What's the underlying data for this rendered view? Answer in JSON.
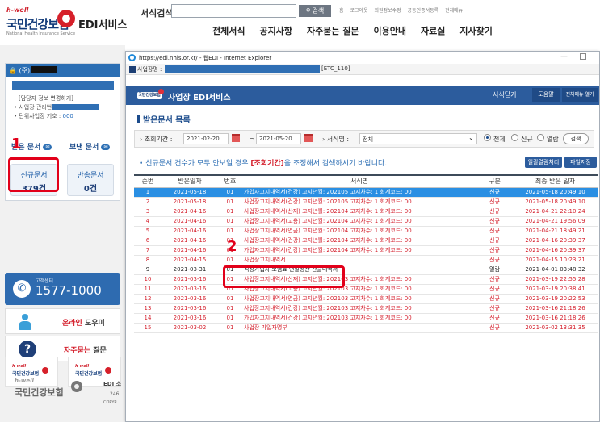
{
  "header": {
    "logo_small": "h-well",
    "logo_main": "국민건강보험",
    "logo_sub": "National Health Insurance Service",
    "service_title": "EDI서비스",
    "search_label": "서식검색",
    "search_value": "",
    "search_button": "검색",
    "util_links": [
      "홈",
      "로그아웃",
      "회원정보수정",
      "공동인증서등록",
      "전체메뉴"
    ],
    "nav": [
      "전체서식",
      "공지사항",
      "자주묻는 질문",
      "이용안내",
      "자료실",
      "지사찾기"
    ]
  },
  "sidebar": {
    "user_prefix": "(주)",
    "user_change": "[담당자 정보 변경하기]",
    "manager_label": "사업장 관리번",
    "unit_label": "단위사업장 기호 : ",
    "unit_value": "000",
    "tab_received": "받은 문서",
    "tab_sent": "보낸 문서",
    "new_docs_label": "신규문서",
    "new_docs_count": "379건",
    "returned_docs_label": "반송문서",
    "returned_docs_count": "0건",
    "annotation_1": "1",
    "call_label": "고객센터",
    "call_number": "1577-1000",
    "online_label": "온라인",
    "online_rest": " 도우미",
    "faq_label": "자주묻는",
    "faq_rest": " 질문",
    "banner_small": "h-well",
    "banner_name": "국민건강보험",
    "footer_small": "h-well",
    "footer_name": "국민건강보험",
    "footer_edi": "EDI 소",
    "footer_num": "246",
    "footer_copy": "COPYR"
  },
  "popup": {
    "window_title": "https://edi.nhis.or.kr/ - 웹EDI - Internet Explorer",
    "addr_label": "사업장명 :",
    "addr_code": "[ETC_110]",
    "app_logo": "국민건강보험",
    "app_title": "사업장 EDI서비스",
    "close_label": "서식닫기",
    "help_label": "도움말",
    "menu_label": "전체메뉴 열기",
    "list_title": "받은문서 목록",
    "filter": {
      "period_label": "조회기간 :",
      "date_from": "2021-02-20",
      "date_to": "2021-05-20",
      "form_label": "서식명 :",
      "form_value": "전체",
      "radio_all": "전체",
      "radio_new": "신규",
      "radio_read": "열람",
      "search_button": "검색"
    },
    "notice_prefix": "신규문서 건수가 모두 안보일 경우 ",
    "notice_highlight": "[조회기간]",
    "notice_suffix": "을 조정해서 검색하시기 바랍니다.",
    "bulk_button": "일괄열람처리",
    "file_button": "파일저장",
    "annotation_2": "2",
    "columns": [
      "순번",
      "받은일자",
      "번호",
      "서식명",
      "구분",
      "최종 받은 일자"
    ],
    "rows": [
      {
        "no": "1",
        "date": "2021-05-18",
        "num": "01",
        "title": "가입자고지내역서(건강) 고지년월: 202105 고지차수: 1 회계코드: 00",
        "type": "신규",
        "last": "2021-05-18 20:49:10"
      },
      {
        "no": "2",
        "date": "2021-05-18",
        "num": "01",
        "title": "사업장고지내역서(건강) 고지년월: 202105 고지차수: 1 회계코드: 00",
        "type": "신규",
        "last": "2021-05-18 20:49:10"
      },
      {
        "no": "3",
        "date": "2021-04-16",
        "num": "01",
        "title": "사업장고지내역서(산재) 고지년월: 202104 고지차수: 1 회계코드: 00",
        "type": "신규",
        "last": "2021-04-21 22:10:24"
      },
      {
        "no": "4",
        "date": "2021-04-16",
        "num": "01",
        "title": "사업장고지내역서(고용) 고지년월: 202104 고지차수: 1 회계코드: 00",
        "type": "신규",
        "last": "2021-04-21 19:56:09"
      },
      {
        "no": "5",
        "date": "2021-04-16",
        "num": "01",
        "title": "사업장고지내역서(연금) 고지년월: 202104 고지차수: 1 회계코드: 00",
        "type": "신규",
        "last": "2021-04-21 18:49:21"
      },
      {
        "no": "6",
        "date": "2021-04-16",
        "num": "01",
        "title": "사업장고지내역서(건강) 고지년월: 202104 고지차수: 1 회계코드: 00",
        "type": "신규",
        "last": "2021-04-16 20:39:37"
      },
      {
        "no": "7",
        "date": "2021-04-16",
        "num": "01",
        "title": "가입자고지내역서(건강) 고지년월: 202104 고지차수: 1 회계코드: 00",
        "type": "신규",
        "last": "2021-04-16 20:39:37"
      },
      {
        "no": "8",
        "date": "2021-04-15",
        "num": "01",
        "title": "사업장고지내역서",
        "type": "신규",
        "last": "2021-04-15 10:23:21"
      },
      {
        "no": "9",
        "date": "2021-03-31",
        "num": "01",
        "title": "직장가입자 보험료 연말정산 산출내역서",
        "type": "열람",
        "last": "2021-04-01 03:48:32"
      },
      {
        "no": "10",
        "date": "2021-03-16",
        "num": "01",
        "title": "사업장고지내역서(산재) 고지년월: 202103 고지차수: 1 회계코드: 00",
        "type": "신규",
        "last": "2021-03-19 22:55:28"
      },
      {
        "no": "11",
        "date": "2021-03-16",
        "num": "01",
        "title": "사업장고지내역서(고용) 고지년월: 202103 고지차수: 1 회계코드: 00",
        "type": "신규",
        "last": "2021-03-19 20:38:41"
      },
      {
        "no": "12",
        "date": "2021-03-16",
        "num": "01",
        "title": "사업장고지내역서(연금) 고지년월: 202103 고지차수: 1 회계코드: 00",
        "type": "신규",
        "last": "2021-03-19 20:22:53"
      },
      {
        "no": "13",
        "date": "2021-03-16",
        "num": "01",
        "title": "사업장고지내역서(건강) 고지년월: 202103 고지차수: 1 회계코드: 00",
        "type": "신규",
        "last": "2021-03-16 21:18:26"
      },
      {
        "no": "14",
        "date": "2021-03-16",
        "num": "01",
        "title": "가입자고지내역서(건강) 고지년월: 202103 고지차수: 1 회계코드: 00",
        "type": "신규",
        "last": "2021-03-16 21:18:26"
      },
      {
        "no": "15",
        "date": "2021-03-02",
        "num": "01",
        "title": "사업장 가입자명부",
        "type": "신규",
        "last": "2021-03-02 13:31:35"
      }
    ]
  },
  "colors": {
    "accent": "#2c5c9d",
    "selected_row": "#2a8fe3",
    "new_doc_text": "#d41f2c",
    "annotation": "#e2001a"
  }
}
